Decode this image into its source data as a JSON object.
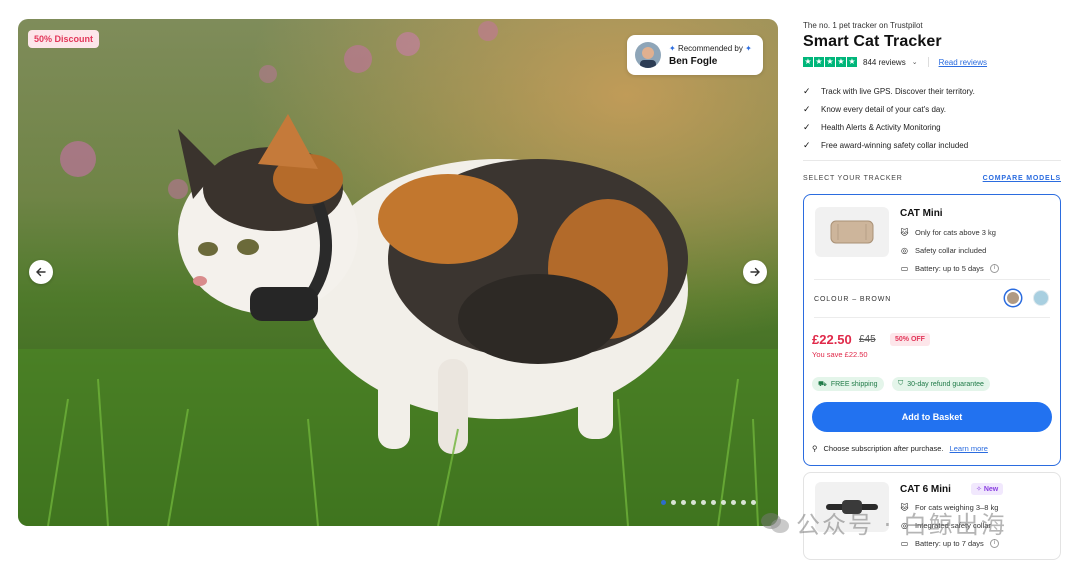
{
  "gallery": {
    "discount_badge": "50% Discount",
    "recommended_label": "Recommended by",
    "recommended_name": "Ben Fogle",
    "dots_total": 10,
    "dots_active_index": 0
  },
  "header": {
    "tagline": "The no. 1 pet tracker on Trustpilot",
    "title": "Smart Cat Tracker",
    "rating_stars": 5,
    "reviews_count": "844 reviews",
    "read_reviews": "Read reviews"
  },
  "features": [
    "Track with live GPS. Discover their territory.",
    "Know every detail of your cat's day.",
    "Health Alerts & Activity Monitoring",
    "Free award-winning safety collar included"
  ],
  "selector": {
    "label": "SELECT YOUR TRACKER",
    "compare": "COMPARE MODELS"
  },
  "product1": {
    "name": "CAT Mini",
    "specs": [
      "Only for cats above 3 kg",
      "Safety collar included",
      "Battery: up to 5 days"
    ],
    "colour_label": "COLOUR – BROWN",
    "price": "£22.50",
    "old_price": "£45",
    "off_badge": "50% OFF",
    "saving": "You save £22.50",
    "shipping": "FREE shipping",
    "refund": "30-day refund guarantee",
    "basket_button": "Add to Basket",
    "subscription_note": "Choose subscription after purchase.",
    "learn_more": "Learn more"
  },
  "product2": {
    "name": "CAT 6 Mini",
    "new_badge": "New",
    "specs": [
      "For cats weighing 3–8 kg",
      "Integrated safety collar",
      "Battery: up to 7 days"
    ]
  },
  "watermark": "公众号 · 白鲸出海",
  "colors": {
    "accent": "#2272f0",
    "price_red": "#e02a4a",
    "trustpilot_green": "#00b67a"
  }
}
